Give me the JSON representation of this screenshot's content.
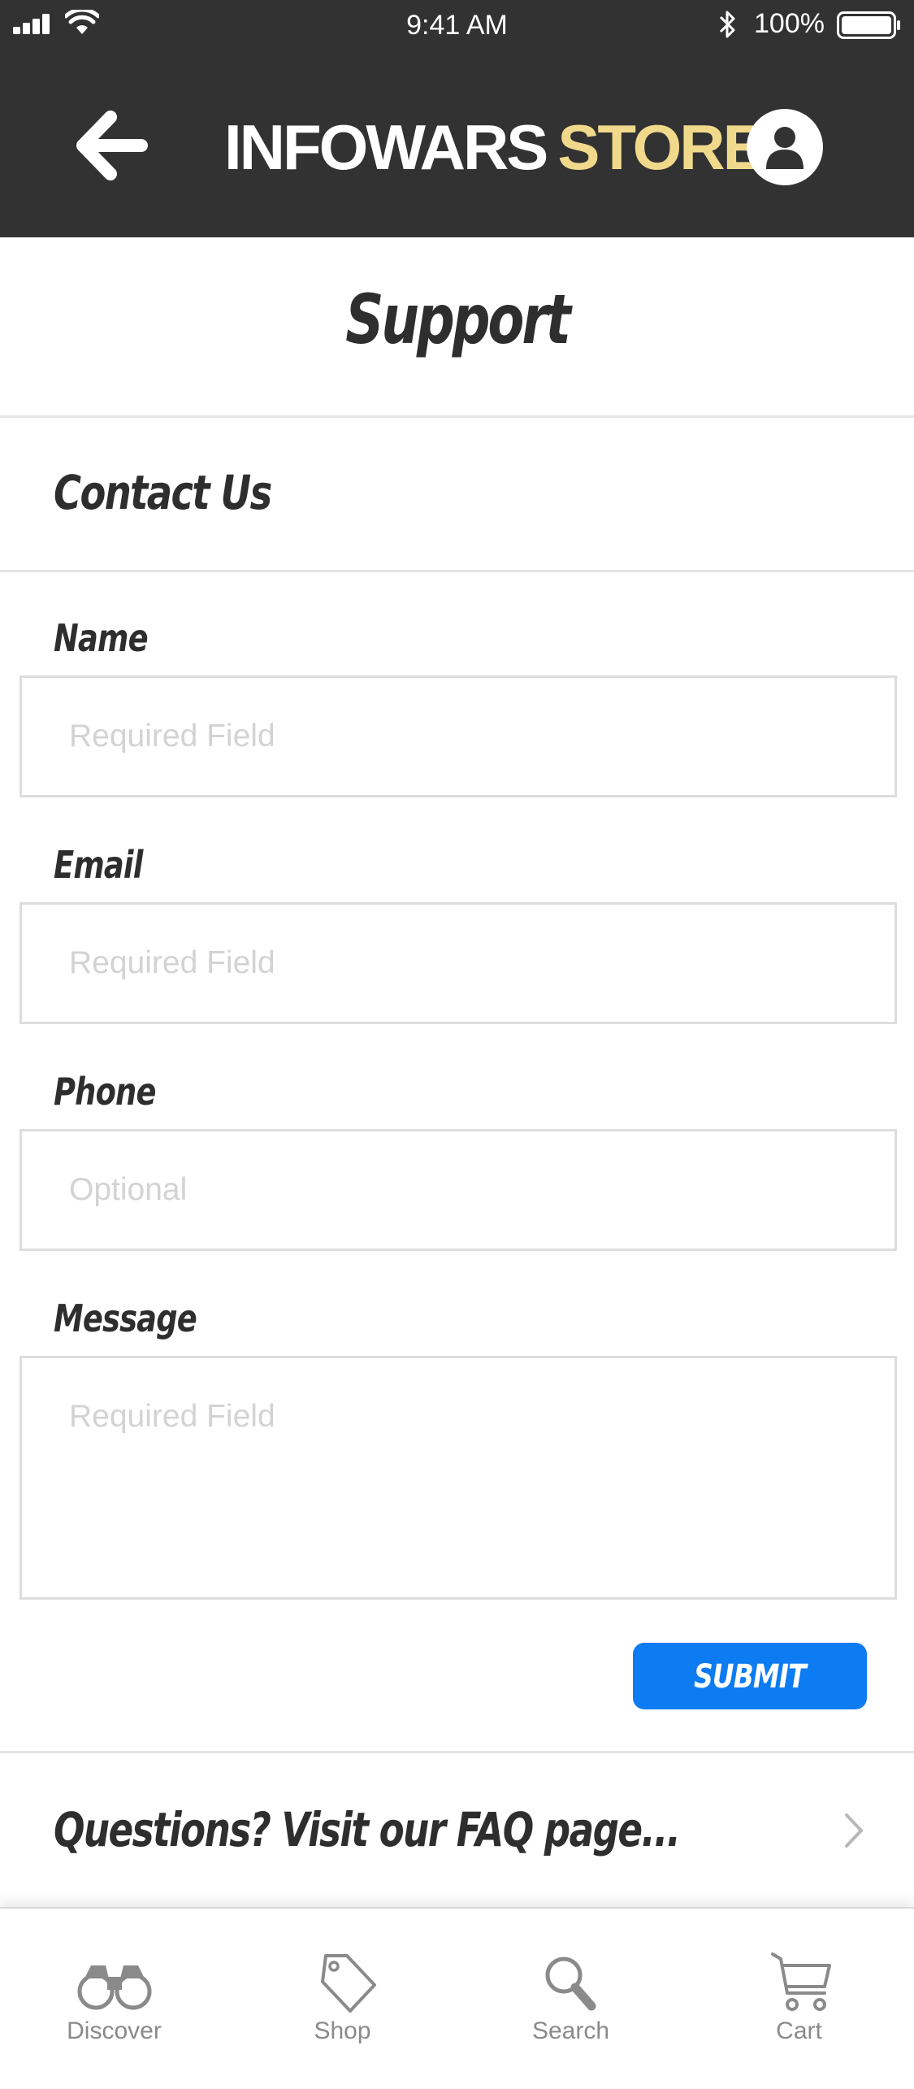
{
  "status_bar": {
    "time": "9:41 AM",
    "battery": "100%"
  },
  "header": {
    "logo_part1": "INFOWARS",
    "logo_part2": "STORE",
    "accent_color": "#f1d98c",
    "background_color": "#323232"
  },
  "page": {
    "title": "Support"
  },
  "contact": {
    "heading": "Contact Us",
    "fields": [
      {
        "label": "Name",
        "placeholder": "Required Field",
        "value": ""
      },
      {
        "label": "Email",
        "placeholder": "Required Field",
        "value": ""
      },
      {
        "label": "Phone",
        "placeholder": "Optional",
        "value": ""
      },
      {
        "label": "Message",
        "placeholder": "Required Field",
        "value": ""
      }
    ],
    "submit_label": "SUBMIT",
    "submit_color": "#0d7bf2"
  },
  "faq": {
    "text": "Questions? Visit our FAQ page..."
  },
  "tab_bar": {
    "items": [
      {
        "label": "Discover",
        "icon": "binoculars-icon"
      },
      {
        "label": "Shop",
        "icon": "price-tag-icon"
      },
      {
        "label": "Search",
        "icon": "magnifier-icon"
      },
      {
        "label": "Cart",
        "icon": "shopping-cart-icon"
      }
    ]
  }
}
